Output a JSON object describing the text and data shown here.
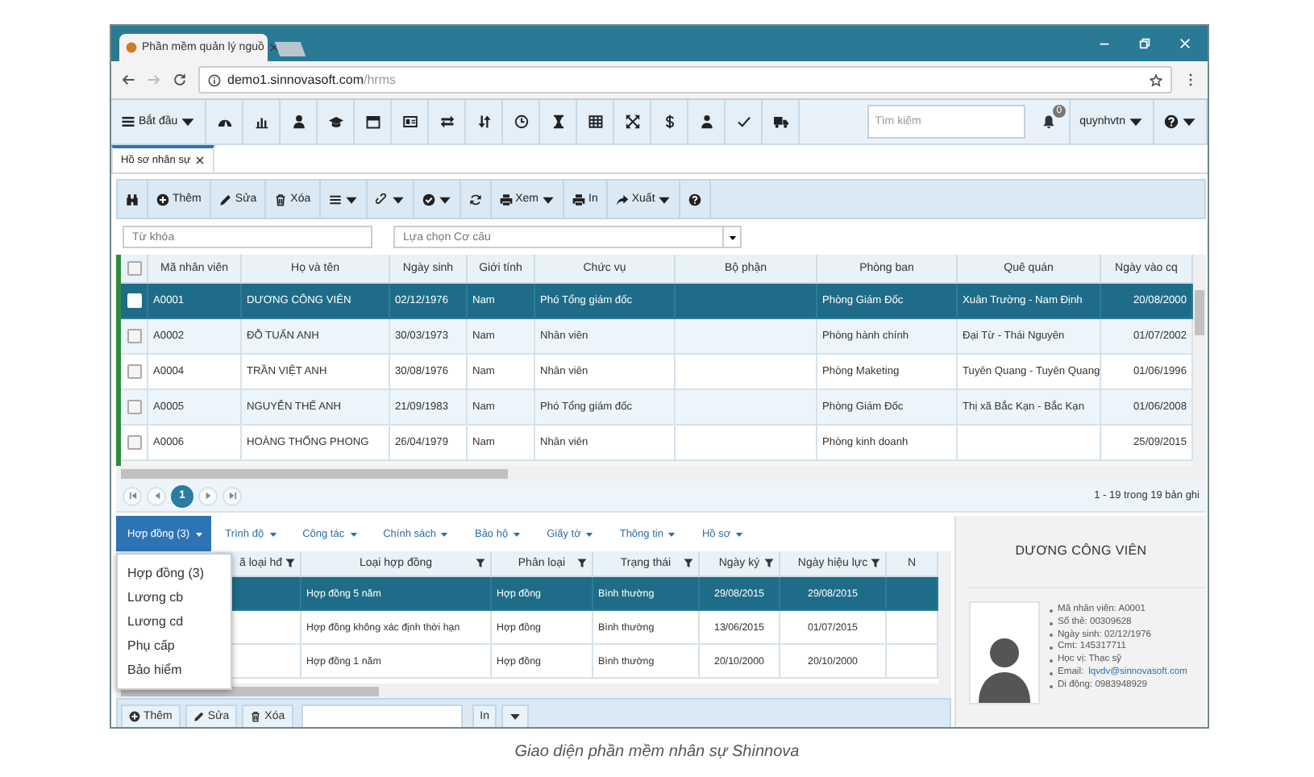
{
  "browser": {
    "tab_title": "Phần mềm quản lý nguồ",
    "url_host": "demo1.sinnovasoft.com",
    "url_path": "/hrms"
  },
  "app_bar": {
    "start_menu": "Bắt đầu",
    "search": {
      "placeholder": "Tìm kiếm"
    },
    "notifications": "0",
    "user": "quynhvtn"
  },
  "page_tabs": [
    {
      "label": "Hồ sơ nhân sự",
      "selected": true
    }
  ],
  "actions": {
    "add": "Thêm",
    "edit": "Sửa",
    "delete": "Xóa",
    "view": "Xem",
    "print": "In",
    "export": "Xuất"
  },
  "filters": {
    "keyword": {
      "placeholder": "Từ khóa"
    },
    "structure": {
      "placeholder": "Lựa chọn Cơ cấu"
    }
  },
  "employees": {
    "select_all": {
      "checked": false
    },
    "columns": [
      "Mã nhân viên",
      "Họ và tên",
      "Ngày sinh",
      "Giới tính",
      "Chức vụ",
      "Bộ phận",
      "Phòng ban",
      "Quê quán",
      "Ngày vào cq"
    ],
    "rows": [
      {
        "selected": true,
        "cells": [
          "A0001",
          "DƯƠNG CÔNG VIÊN",
          "02/12/1976",
          "Nam",
          "Phó Tổng giám đốc",
          null,
          "Phòng Giám Đốc",
          "Xuân Trường - Nam Định",
          "20/08/2000"
        ]
      },
      {
        "selected": false,
        "cells": [
          "A0002",
          "ĐỖ TUẤN ANH",
          "30/03/1973",
          "Nam",
          "Nhân viên",
          null,
          "Phòng hành chính",
          "Đại Từ - Thái Nguyên",
          "01/07/2002"
        ]
      },
      {
        "selected": false,
        "cells": [
          "A0004",
          "TRẦN VIỆT ANH",
          "30/08/1976",
          "Nam",
          "Nhân viên",
          null,
          "Phòng Maketing",
          "Tuyên Quang - Tuyên Quang",
          "01/06/1996"
        ]
      },
      {
        "selected": false,
        "cells": [
          "A0005",
          "NGUYỄN THẾ ANH",
          "21/09/1983",
          "Nam",
          "Phó Tổng giám đốc",
          null,
          "Phòng Giám Đốc",
          "Thị xã Bắc Kạn - Bắc Kạn",
          "01/06/2008"
        ]
      },
      {
        "selected": false,
        "cells": [
          "A0006",
          "HOÀNG THỐNG PHONG",
          "26/04/1979",
          "Nam",
          "Nhân viên",
          null,
          "Phòng kinh doanh",
          null,
          "25/09/2015"
        ]
      }
    ]
  },
  "pager": {
    "pages": [
      {
        "label": "1",
        "selected": true
      }
    ],
    "summary": "1 - 19 trong 19 bản ghi"
  },
  "sub_tabs": [
    {
      "label": "Hợp đồng (3)",
      "selected": true
    },
    {
      "label": "Trình độ",
      "selected": false
    },
    {
      "label": "Công tác",
      "selected": false
    },
    {
      "label": "Chính sách",
      "selected": false
    },
    {
      "label": "Bảo hộ",
      "selected": false
    },
    {
      "label": "Giấy tờ",
      "selected": false
    },
    {
      "label": "Thông tin",
      "selected": false
    },
    {
      "label": "Hồ sơ",
      "selected": false
    }
  ],
  "sub_menu": [
    "Hợp đồng (3)",
    "Lương cb",
    "Lương cd",
    "Phụ cấp",
    "Bảo hiểm"
  ],
  "contracts": {
    "columns": [
      "ã loại hđ",
      "Loại hợp đồng",
      "Phân loại",
      "Trạng thái",
      "Ngày ký",
      "Ngày hiệu lực",
      "N"
    ],
    "rows": [
      {
        "selected": true,
        "cells": [
          null,
          "Hợp đồng 5 năm",
          "Hợp đồng",
          "Bình thường",
          "29/08/2015",
          "29/08/2015",
          null
        ]
      },
      {
        "selected": false,
        "cells": [
          null,
          "Hợp đồng không xác định thời hạn",
          "Hợp đồng",
          "Bình thường",
          "13/06/2015",
          "01/07/2015",
          null
        ]
      },
      {
        "selected": false,
        "cells": [
          null,
          "Hợp đồng 1 năm",
          "Hợp đồng",
          "Bình thường",
          "20/10/2000",
          "20/10/2000",
          null
        ]
      }
    ]
  },
  "contract_toolbar": {
    "add": "Thêm",
    "edit": "Sửa",
    "delete": "Xóa",
    "print": "In"
  },
  "profile": {
    "name": "DƯƠNG CÔNG VIÊN",
    "details": [
      {
        "kind": "text",
        "text": "Mã nhân viên: A0001"
      },
      {
        "kind": "text",
        "text": "Số thẻ: 00309628"
      },
      {
        "kind": "text",
        "text": "Ngày sinh: 02/12/1976"
      },
      {
        "kind": "text",
        "text": "Cmt: 145317711"
      },
      {
        "kind": "text",
        "text": "Học vị: Thạc sỹ"
      },
      {
        "kind": "link",
        "label": "Email:",
        "text": "lqvdv@sinnovasoft.com"
      },
      {
        "kind": "text",
        "text": "Di động: 0983948929"
      }
    ]
  },
  "caption": "Giao diện phần mềm nhân sự Shinnova"
}
